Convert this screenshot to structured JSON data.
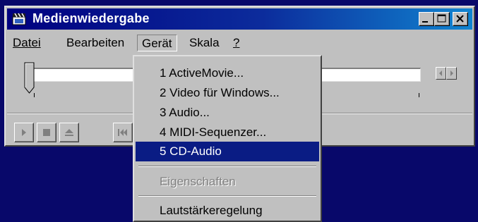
{
  "window": {
    "title": "Medienwiedergabe"
  },
  "menubar": {
    "items": [
      {
        "label": "Datei"
      },
      {
        "label": "Bearbeiten"
      },
      {
        "label": "Gerät"
      },
      {
        "label": "Skala"
      },
      {
        "label": "?"
      }
    ]
  },
  "device_menu": {
    "items": [
      {
        "label": "1 ActiveMovie..."
      },
      {
        "label": "2 Video für Windows..."
      },
      {
        "label": "3 Audio..."
      },
      {
        "label": "4 MIDI-Sequenzer..."
      },
      {
        "label": "5 CD-Audio",
        "selected": true
      },
      {
        "label": "Eigenschaften",
        "disabled": true
      },
      {
        "label": "Lautstärkeregelung"
      }
    ]
  },
  "trackbar": {
    "position": 0
  },
  "toolbar": {
    "buttons": [
      "play-icon",
      "stop-icon",
      "eject-icon",
      "previous-mark-icon"
    ]
  },
  "colors": {
    "title_bar": "#000080",
    "selection": "#0a1c84",
    "desktop": "#08086a",
    "face": "#c0c0c0"
  }
}
